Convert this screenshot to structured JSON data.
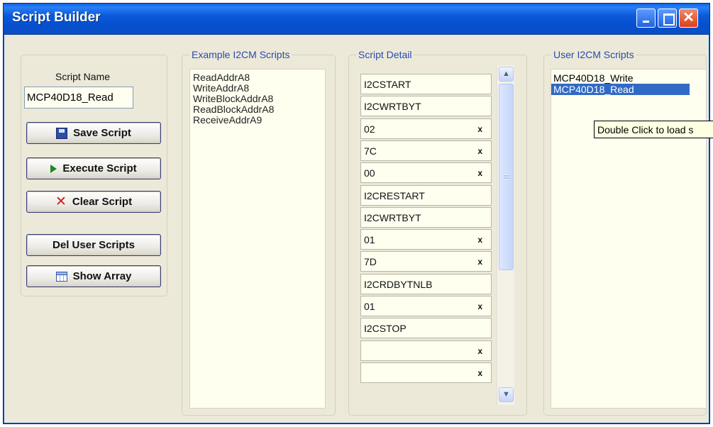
{
  "window": {
    "title": "Script Builder"
  },
  "left_panel": {
    "name_label": "Script Name",
    "name_value": "MCP40D18_Read",
    "buttons": {
      "save": "Save Script",
      "execute": "Execute Script",
      "clear": "Clear Script",
      "del_user": "Del User Scripts",
      "show_array": "Show Array"
    }
  },
  "examples": {
    "title": "Example I2CM Scripts",
    "items": [
      "ReadAddrA8",
      "WriteAddrA8",
      "WriteBlockAddrA8",
      "ReadBlockAddrA8",
      "ReceiveAddrA9"
    ]
  },
  "detail": {
    "title": "Script Detail",
    "delete_mark": "x",
    "rows": [
      {
        "text": "I2CSTART",
        "deletable": false
      },
      {
        "text": "I2CWRTBYT",
        "deletable": false
      },
      {
        "text": "02",
        "deletable": true
      },
      {
        "text": "7C",
        "deletable": true
      },
      {
        "text": "00",
        "deletable": true
      },
      {
        "text": "I2CRESTART",
        "deletable": false
      },
      {
        "text": "I2CWRTBYT",
        "deletable": false
      },
      {
        "text": "01",
        "deletable": true
      },
      {
        "text": "7D",
        "deletable": true
      },
      {
        "text": "I2CRDBYTNLB",
        "deletable": false
      },
      {
        "text": "01",
        "deletable": true
      },
      {
        "text": "I2CSTOP",
        "deletable": false
      },
      {
        "text": "",
        "deletable": true
      },
      {
        "text": "",
        "deletable": true
      }
    ]
  },
  "user_scripts": {
    "title": "User I2CM Scripts",
    "items": [
      "MCP40D18_Write",
      "MCP40D18_Read"
    ],
    "selected_index": 1,
    "tooltip": "Double Click to load s"
  },
  "colors": {
    "title_bar": "#0a5ad9",
    "selection": "#316ac5",
    "group_label": "#2a4ab0",
    "list_bg": "#fffff0"
  },
  "icons": {
    "save": "save-disk-icon",
    "execute": "play-icon",
    "clear": "red-x-icon",
    "show_array": "table-grid-icon"
  }
}
